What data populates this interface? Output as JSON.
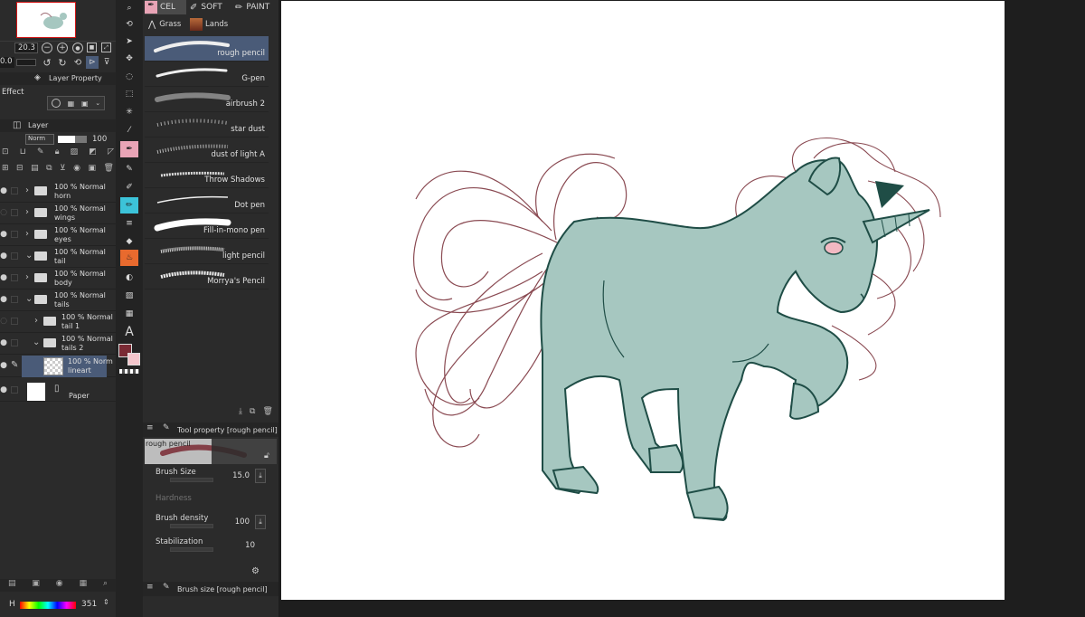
{
  "navigator": {
    "zoom": "20.3",
    "rotate": "0.0"
  },
  "layer_property": {
    "tab_label": "Layer Property",
    "effect_label": "Effect"
  },
  "layer_panel": {
    "tab_label": "Layer",
    "blend_mode": "Norm",
    "opacity": "100",
    "rows": [
      {
        "line1": "100 % Normal",
        "line2": "horn"
      },
      {
        "line1": "100 % Normal",
        "line2": "wings"
      },
      {
        "line1": "100 % Normal",
        "line2": "eyes"
      },
      {
        "line1": "100 % Normal",
        "line2": "tail"
      },
      {
        "line1": "100 % Normal",
        "line2": "body"
      },
      {
        "line1": "100 % Normal",
        "line2": "tails"
      },
      {
        "line1": "100 % Normal",
        "line2": "tail 1"
      },
      {
        "line1": "100 % Normal",
        "line2": "tails 2"
      },
      {
        "line1": "100 % Norm",
        "line2": "lineart"
      },
      {
        "line1": "",
        "line2": "Paper"
      }
    ]
  },
  "color_bar": {
    "channel": "H",
    "value": "351"
  },
  "sub_tool_tabs": {
    "tabs": [
      "CEL",
      "SOFT",
      "PAINT"
    ],
    "groups": [
      "Grass",
      "Lands"
    ]
  },
  "brushes": [
    "rough pencil",
    "G-pen",
    "airbrush 2",
    "star dust",
    "dust of light A",
    "Throw Shadows",
    "Dot pen",
    "Fill-in-mono pen",
    "light pencil",
    "Morrya's Pencil"
  ],
  "tool_property": {
    "title": "Tool property [rough pencil]",
    "preview_label": "rough pencil",
    "brush_size_label": "Brush Size",
    "brush_size_value": "15.0",
    "hardness_label": "Hardness",
    "brush_density_label": "Brush density",
    "brush_density_value": "100",
    "stabilization_label": "Stabilization",
    "stabilization_value": "10"
  },
  "brush_size_panel": {
    "title": "Brush size [rough pencil]"
  },
  "colors": {
    "main": "#7a2a34",
    "sub": "#f4c6cc",
    "unicorn_fill": "#a6c7c0",
    "unicorn_line": "#1f4d46",
    "hair_line": "#8a4a52",
    "selected_row": "#4a5b78"
  }
}
